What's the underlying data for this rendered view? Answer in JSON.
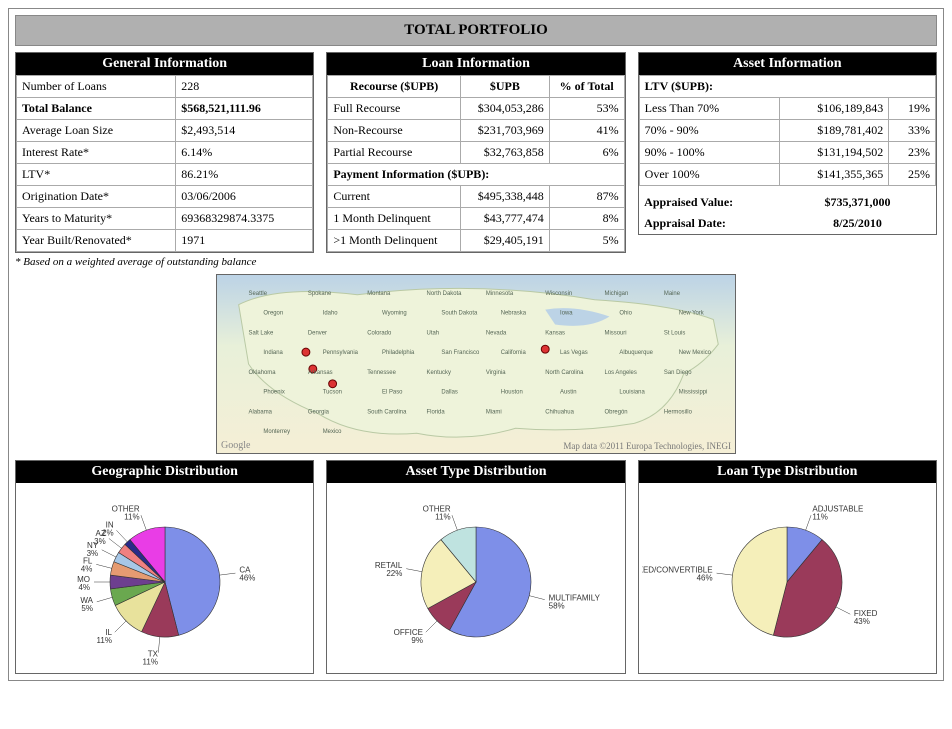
{
  "title": "TOTAL PORTFOLIO",
  "general": {
    "header": "General Information",
    "rows": [
      {
        "label": "Number of Loans",
        "value": "228"
      },
      {
        "label": "Total Balance",
        "value": "$568,521,111.96",
        "bold": true
      },
      {
        "label": "Average Loan Size",
        "value": "$2,493,514"
      },
      {
        "label": "Interest Rate*",
        "value": "6.14%"
      },
      {
        "label": "LTV*",
        "value": "86.21%"
      },
      {
        "label": "Origination Date*",
        "value": "03/06/2006"
      },
      {
        "label": "Years to Maturity*",
        "value": "69368329874.3375"
      },
      {
        "label": "Year Built/Renovated*",
        "value": "1971"
      }
    ],
    "footnote": "* Based on a weighted average of outstanding balance"
  },
  "loan": {
    "header": "Loan Information",
    "subhead": {
      "c1": "Recourse ($UPB)",
      "c2": "$UPB",
      "c3": "% of Total"
    },
    "recourse_rows": [
      {
        "label": "Full Recourse",
        "upb": "$304,053,286",
        "pct": "53%"
      },
      {
        "label": "Non-Recourse",
        "upb": "$231,703,969",
        "pct": "41%"
      },
      {
        "label": "Partial Recourse",
        "upb": "$32,763,858",
        "pct": "6%"
      }
    ],
    "payment_head": "Payment Information ($UPB):",
    "payment_rows": [
      {
        "label": "Current",
        "upb": "$495,338,448",
        "pct": "87%"
      },
      {
        "label": "1 Month Delinquent",
        "upb": "$43,777,474",
        "pct": "8%"
      },
      {
        "label": ">1 Month Delinquent",
        "upb": "$29,405,191",
        "pct": "5%"
      }
    ]
  },
  "asset": {
    "header": "Asset Information",
    "ltv_head": "LTV ($UPB):",
    "ltv_rows": [
      {
        "label": "Less Than 70%",
        "upb": "$106,189,843",
        "pct": "19%"
      },
      {
        "label": "70% - 90%",
        "upb": "$189,781,402",
        "pct": "33%"
      },
      {
        "label": "90% - 100%",
        "upb": "$131,194,502",
        "pct": "23%"
      },
      {
        "label": "Over 100%",
        "upb": "$141,355,365",
        "pct": "25%"
      }
    ],
    "appraised_label": "Appraised Value:",
    "appraised_value": "$735,371,000",
    "appraisal_date_label": "Appraisal Date:",
    "appraisal_date_value": "8/25/2010"
  },
  "map": {
    "credit": "Google",
    "credit2": "Map data ©2011 Europa Technologies, INEGI",
    "labels": [
      "Seattle",
      "Spokane",
      "Montana",
      "North Dakota",
      "Minnesota",
      "Wisconsin",
      "Michigan",
      "Maine",
      "Oregon",
      "Idaho",
      "Wyoming",
      "South Dakota",
      "Nebraska",
      "Iowa",
      "Ohio",
      "New York",
      "Salt Lake",
      "Denver",
      "Colorado",
      "Utah",
      "Nevada",
      "Kansas",
      "Missouri",
      "St Louis",
      "Indiana",
      "Pennsylvania",
      "Philadelphia",
      "San Francisco",
      "California",
      "Las Vegas",
      "Albuquerque",
      "New Mexico",
      "Oklahoma",
      "Arkansas",
      "Tennessee",
      "Kentucky",
      "Virginia",
      "North Carolina",
      "Los Angeles",
      "San Diego",
      "Phoenix",
      "Tucson",
      "El Paso",
      "Dallas",
      "Houston",
      "Austin",
      "Louisiana",
      "Mississippi",
      "Alabama",
      "Georgia",
      "South Carolina",
      "Florida",
      "Miami",
      "Chihuahua",
      "Obregón",
      "Hermosillo",
      "Monterrey",
      "Mexico"
    ]
  },
  "chart_data": [
    {
      "type": "pie",
      "title": "Geographic Distribution",
      "series": [
        {
          "name": "CA",
          "value": 46,
          "color": "#7e8fe8"
        },
        {
          "name": "TX",
          "value": 11,
          "color": "#9a3a5a"
        },
        {
          "name": "IL",
          "value": 11,
          "color": "#e8e29c"
        },
        {
          "name": "WA",
          "value": 5,
          "color": "#6aa84f"
        },
        {
          "name": "MO",
          "value": 4,
          "color": "#6d3f8f"
        },
        {
          "name": "FL",
          "value": 4,
          "color": "#e59b72"
        },
        {
          "name": "NY",
          "value": 3,
          "color": "#a7c7e7"
        },
        {
          "name": "AZ",
          "value": 3,
          "color": "#f08080"
        },
        {
          "name": "IN",
          "value": 2,
          "color": "#2a2a8a"
        },
        {
          "name": "Other",
          "value": 11,
          "color": "#e93de6"
        }
      ]
    },
    {
      "type": "pie",
      "title": "Asset Type Distribution",
      "series": [
        {
          "name": "MULTIFAMILY",
          "value": 58,
          "color": "#7e8fe8"
        },
        {
          "name": "OFFICE",
          "value": 9,
          "color": "#9a3a5a"
        },
        {
          "name": "RETAIL",
          "value": 22,
          "color": "#f5efba"
        },
        {
          "name": "OTHER",
          "value": 11,
          "color": "#bfe3e0"
        }
      ]
    },
    {
      "type": "pie",
      "title": "Loan Type Distribution",
      "series": [
        {
          "name": "ADJUSTABLE",
          "value": 11,
          "color": "#7e8fe8"
        },
        {
          "name": "FIXED",
          "value": 43,
          "color": "#9a3a5a"
        },
        {
          "name": "FIXED/CONVERTIBLE",
          "value": 46,
          "color": "#f5efba"
        }
      ]
    }
  ]
}
